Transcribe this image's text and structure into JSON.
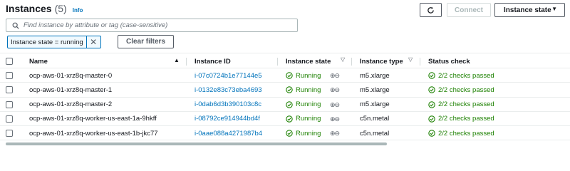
{
  "header": {
    "title": "Instances",
    "count": "(5)",
    "info": "Info"
  },
  "toolbar": {
    "refresh_icon": "refresh-icon",
    "connect": "Connect",
    "instance_state": "Instance state"
  },
  "search": {
    "placeholder": "Find instance by attribute or tag (case-sensitive)"
  },
  "filter": {
    "token": "Instance state = running",
    "clear": "Clear filters"
  },
  "table": {
    "columns": {
      "name": "Name",
      "instance_id": "Instance ID",
      "instance_state": "Instance state",
      "instance_type": "Instance type",
      "status_check": "Status check"
    },
    "rows": [
      {
        "name": "ocp-aws-01-xrz8q-master-0",
        "id": "i-07c0724b1e77144e5",
        "state": "Running",
        "type": "m5.xlarge",
        "status": "2/2 checks passed"
      },
      {
        "name": "ocp-aws-01-xrz8q-master-1",
        "id": "i-0132e83c73eba4693",
        "state": "Running",
        "type": "m5.xlarge",
        "status": "2/2 checks passed"
      },
      {
        "name": "ocp-aws-01-xrz8q-master-2",
        "id": "i-0dab6d3b390103c8c",
        "state": "Running",
        "type": "m5.xlarge",
        "status": "2/2 checks passed"
      },
      {
        "name": "ocp-aws-01-xrz8q-worker-us-east-1a-9hkff",
        "id": "i-08792ce914944bd4f",
        "state": "Running",
        "type": "c5n.metal",
        "status": "2/2 checks passed"
      },
      {
        "name": "ocp-aws-01-xrz8q-worker-us-east-1b-jkc77",
        "id": "i-0aae088a4271987b4",
        "state": "Running",
        "type": "c5n.metal",
        "status": "2/2 checks passed"
      }
    ]
  },
  "colors": {
    "link": "#0073bb",
    "success": "#1d8102"
  }
}
